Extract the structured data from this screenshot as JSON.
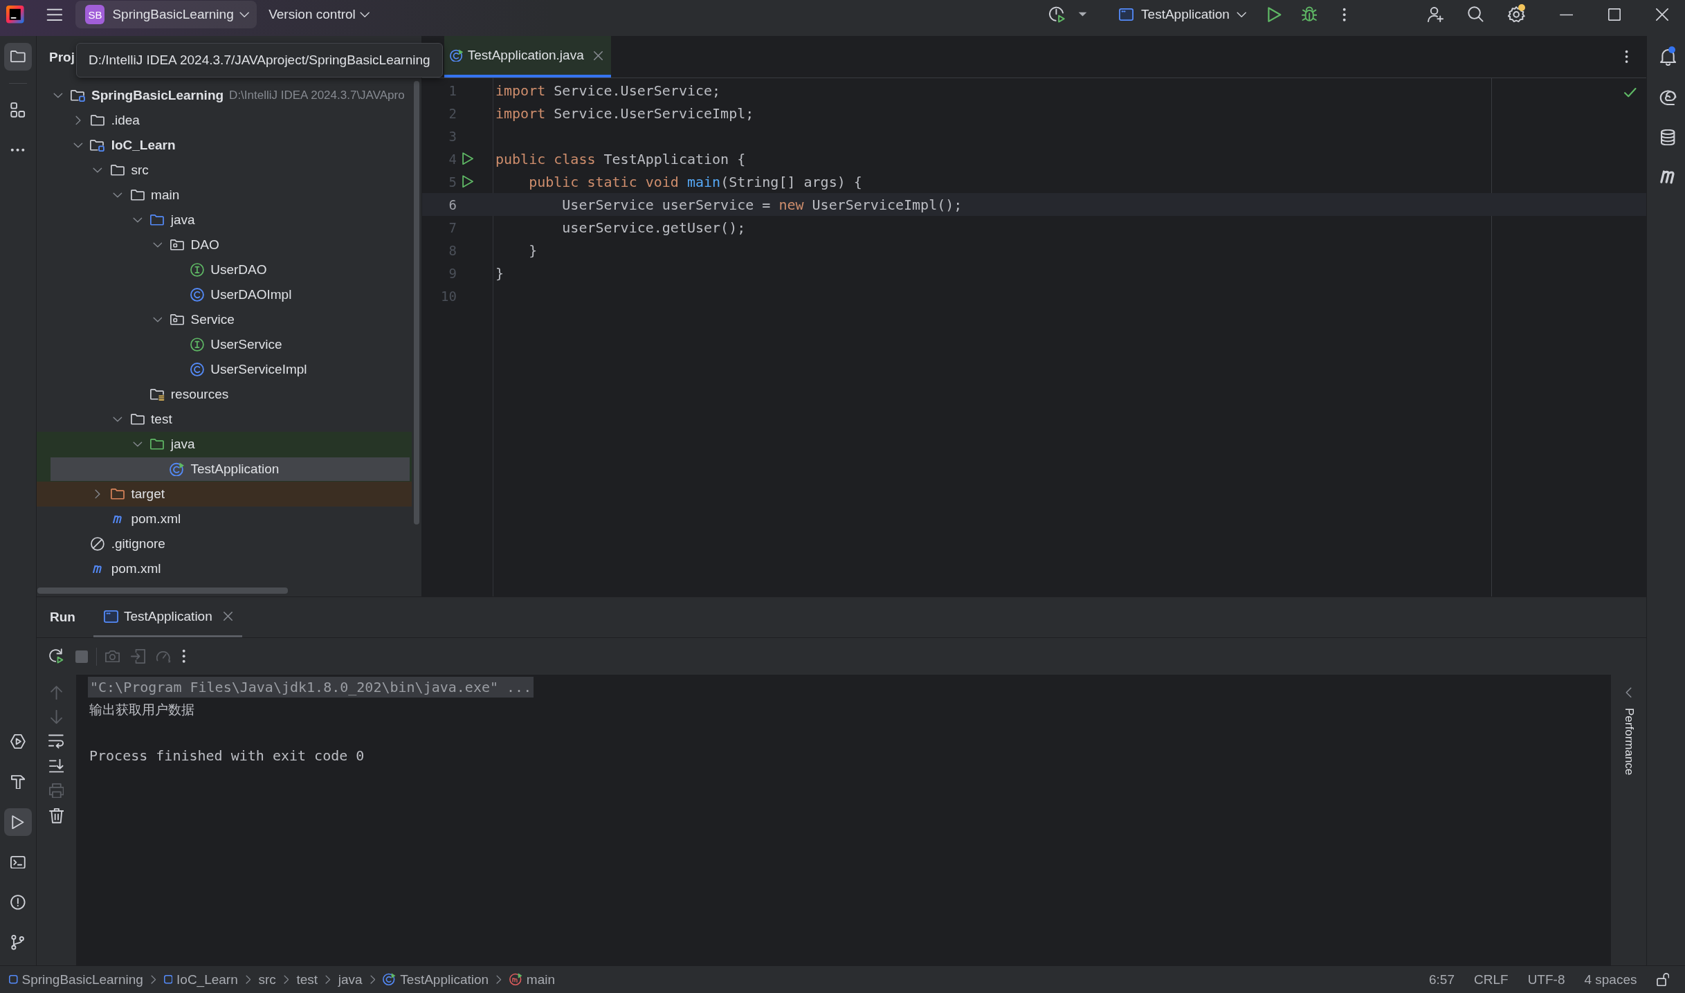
{
  "title_bar": {
    "project_badge": "SB",
    "project": "SpringBasicLearning",
    "vcs": "Version control",
    "run_config": "TestApplication",
    "settings_badge": true
  },
  "tool_strip_left": {
    "top": [
      {
        "kind": "project",
        "selected": true
      },
      {
        "kind": "structure",
        "selected": false
      },
      {
        "kind": "more",
        "selected": false
      }
    ],
    "bottom": [
      {
        "kind": "services",
        "selected": false
      },
      {
        "kind": "build",
        "selected": false
      },
      {
        "kind": "run",
        "selected": true
      },
      {
        "kind": "terminal",
        "selected": false
      },
      {
        "kind": "problems",
        "selected": false
      },
      {
        "kind": "git",
        "selected": false
      }
    ]
  },
  "project_panel": {
    "title": "Proj",
    "tooltip": "D:/IntelliJ IDEA 2024.3.7/JAVAproject/SpringBasicLearning",
    "tree": [
      {
        "label": "SpringBasicLearning",
        "kind": "module",
        "path": "D:\\IntelliJ IDEA 2024.3.7\\JAVApro",
        "expanded": true,
        "selected": false,
        "children": [
          {
            "label": ".idea",
            "kind": "folder",
            "expanded": false,
            "selected": false
          },
          {
            "label": "IoC_Learn",
            "kind": "module",
            "expanded": true,
            "selected": false,
            "children": [
              {
                "label": "src",
                "kind": "folder",
                "expanded": true,
                "selected": false,
                "children": [
                  {
                    "label": "main",
                    "kind": "folder",
                    "expanded": true,
                    "selected": false,
                    "children": [
                      {
                        "label": "java",
                        "kind": "source_root",
                        "expanded": true,
                        "selected": false,
                        "children": [
                          {
                            "label": "DAO",
                            "kind": "package",
                            "expanded": true,
                            "selected": false,
                            "children": [
                              {
                                "label": "UserDAO",
                                "kind": "interface",
                                "selected": false
                              },
                              {
                                "label": "UserDAOImpl",
                                "kind": "class",
                                "selected": false
                              }
                            ]
                          },
                          {
                            "label": "Service",
                            "kind": "package",
                            "expanded": true,
                            "selected": false,
                            "children": [
                              {
                                "label": "UserService",
                                "kind": "interface",
                                "selected": false
                              },
                              {
                                "label": "UserServiceImpl",
                                "kind": "class",
                                "selected": false
                              }
                            ]
                          }
                        ]
                      },
                      {
                        "label": "resources",
                        "kind": "resources_root",
                        "selected": false
                      }
                    ]
                  },
                  {
                    "label": "test",
                    "kind": "folder",
                    "expanded": true,
                    "selected": false,
                    "children": [
                      {
                        "label": "java",
                        "kind": "test_root",
                        "expanded": true,
                        "selected": false,
                        "children": [
                          {
                            "label": "TestApplication",
                            "kind": "main_class",
                            "selected": true
                          }
                        ]
                      }
                    ]
                  }
                ]
              },
              {
                "label": "target",
                "kind": "excluded",
                "expanded": false,
                "selected": false
              },
              {
                "label": "pom.xml",
                "kind": "maven",
                "selected": false
              }
            ]
          },
          {
            "label": ".gitignore",
            "kind": "ignore",
            "selected": false
          },
          {
            "label": "pom.xml",
            "kind": "maven",
            "selected": false
          }
        ]
      }
    ]
  },
  "editor": {
    "tabs": [
      {
        "label": "TestApplication.java",
        "selected": true
      }
    ],
    "no_problems": true,
    "lines": [
      {
        "number": "1",
        "current": false,
        "runnable": false,
        "tokens": [
          {
            "kind": "keyword",
            "text": "import"
          },
          {
            "kind": "plain",
            "text": " Service.UserService;"
          }
        ]
      },
      {
        "number": "2",
        "current": false,
        "runnable": false,
        "tokens": [
          {
            "kind": "keyword",
            "text": "import"
          },
          {
            "kind": "plain",
            "text": " Service.UserServiceImpl;"
          }
        ]
      },
      {
        "number": "3",
        "current": false,
        "runnable": false
      },
      {
        "number": "4",
        "current": false,
        "runnable": true,
        "tokens": [
          {
            "kind": "keyword",
            "text": "public class"
          },
          {
            "kind": "plain",
            "text": " TestApplication {"
          }
        ]
      },
      {
        "number": "5",
        "current": false,
        "runnable": true,
        "tokens": [
          {
            "kind": "keyword",
            "text": "    public static void"
          },
          {
            "kind": "method",
            "text": " main"
          },
          {
            "kind": "plain",
            "text": "(String[] args) {"
          }
        ]
      },
      {
        "number": "6",
        "current": true,
        "runnable": false,
        "tokens": [
          {
            "kind": "plain",
            "text": "        UserService userService = "
          },
          {
            "kind": "keyword",
            "text": "new"
          },
          {
            "kind": "plain",
            "text": " UserServiceImpl();"
          }
        ]
      },
      {
        "number": "7",
        "current": false,
        "runnable": false,
        "tokens": [
          {
            "kind": "plain",
            "text": "        userService.getUser();"
          }
        ]
      },
      {
        "number": "8",
        "current": false,
        "runnable": false,
        "tokens": [
          {
            "kind": "plain",
            "text": "    }"
          }
        ]
      },
      {
        "number": "9",
        "current": false,
        "runnable": false,
        "tokens": [
          {
            "kind": "plain",
            "text": "}"
          }
        ]
      },
      {
        "number": "10",
        "current": false,
        "runnable": false
      }
    ]
  },
  "tool_strip_right": {
    "notifications_badge": true
  },
  "run_panel": {
    "title": "Run",
    "tabs": [
      {
        "label": "TestApplication",
        "selected": true
      }
    ],
    "toolbar": [
      [
        {
          "kind": "rerun",
          "disabled": false
        },
        {
          "kind": "stop",
          "disabled": true
        }
      ],
      [
        {
          "kind": "screenshot",
          "disabled": true
        },
        {
          "kind": "import",
          "disabled": true
        },
        {
          "kind": "profiler",
          "disabled": true
        },
        {
          "kind": "more",
          "disabled": false
        }
      ]
    ],
    "side_toolbar": [
      {
        "kind": "up",
        "disabled": true
      },
      {
        "kind": "down",
        "disabled": true
      },
      {
        "kind": "soft_wrap",
        "disabled": false
      },
      {
        "kind": "scroll_end",
        "disabled": false
      },
      {
        "kind": "print",
        "disabled": true
      },
      {
        "kind": "clear",
        "disabled": false
      }
    ],
    "console": [
      {
        "kind": "command",
        "text": "\"C:\\Program Files\\Java\\jdk1.8.0_202\\bin\\java.exe\" ..."
      },
      {
        "kind": "output",
        "text": "输出获取用户数据"
      },
      {
        "kind": "blank"
      },
      {
        "kind": "system",
        "text": "Process finished with exit code 0"
      }
    ],
    "side_tab": "Performance"
  },
  "status_bar": {
    "breadcrumbs": [
      {
        "label": "SpringBasicLearning",
        "kind": "module"
      },
      {
        "label": "IoC_Learn",
        "kind": "module"
      },
      {
        "label": "src",
        "kind": "folder"
      },
      {
        "label": "test",
        "kind": "folder"
      },
      {
        "label": "java",
        "kind": "folder"
      },
      {
        "label": "TestApplication",
        "kind": "main_class"
      },
      {
        "label": "main",
        "kind": "main_method"
      }
    ],
    "items": [
      "6:57",
      "CRLF",
      "UTF-8",
      "4 spaces"
    ]
  }
}
